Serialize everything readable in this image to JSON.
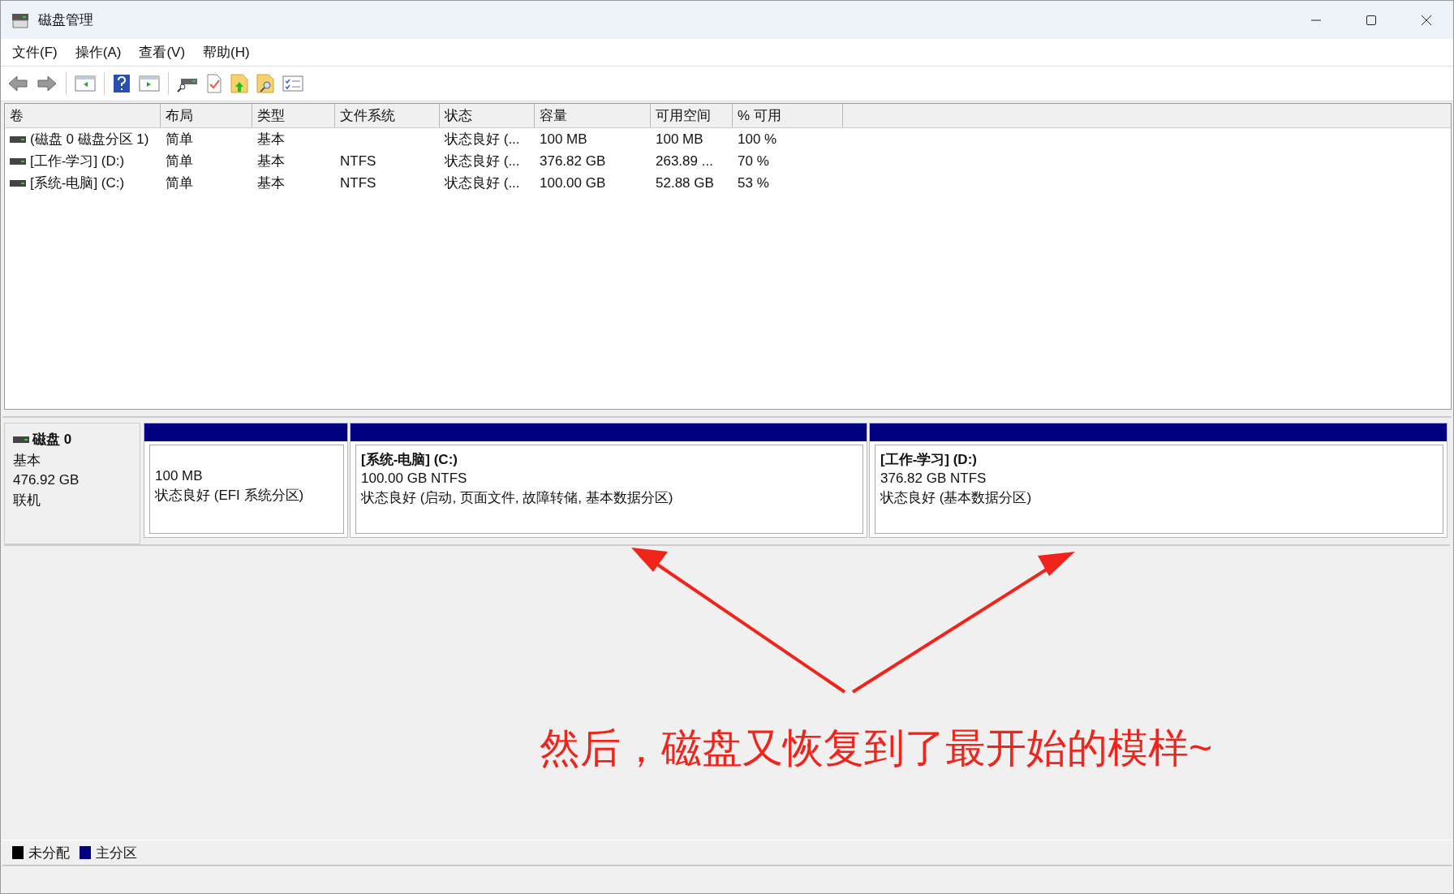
{
  "window": {
    "title": "磁盘管理"
  },
  "menu": [
    "文件(F)",
    "操作(A)",
    "查看(V)",
    "帮助(H)"
  ],
  "table": {
    "columns": [
      "卷",
      "布局",
      "类型",
      "文件系统",
      "状态",
      "容量",
      "可用空间",
      "% 可用"
    ],
    "rows": [
      {
        "cells": [
          "(磁盘 0 磁盘分区 1)",
          "简单",
          "基本",
          "",
          "状态良好 (...",
          "100 MB",
          "100 MB",
          "100 %"
        ]
      },
      {
        "cells": [
          "[工作-学习] (D:)",
          "简单",
          "基本",
          "NTFS",
          "状态良好 (...",
          "376.82 GB",
          "263.89 ...",
          "70 %"
        ]
      },
      {
        "cells": [
          "[系统-电脑] (C:)",
          "简单",
          "基本",
          "NTFS",
          "状态良好 (...",
          "100.00 GB",
          "52.88 GB",
          "53 %"
        ]
      }
    ]
  },
  "disk": {
    "name": "磁盘 0",
    "type": "基本",
    "size": "476.92 GB",
    "status": "联机",
    "partitions": [
      {
        "size": "100 MB",
        "status": "状态良好 (EFI 系统分区)",
        "color": "#000080"
      },
      {
        "title": "[系统-电脑]  (C:)",
        "size": "100.00 GB NTFS",
        "status": "状态良好 (启动, 页面文件, 故障转储, 基本数据分区)",
        "color": "#000080"
      },
      {
        "title": "[工作-学习]  (D:)",
        "size": "376.82 GB NTFS",
        "status": "状态良好 (基本数据分区)",
        "color": "#000080"
      }
    ]
  },
  "annotation": {
    "text": "然后，磁盘又恢复到了最开始的模样~"
  },
  "legend": [
    {
      "label": "未分配",
      "color": "#000000"
    },
    {
      "label": "主分区",
      "color": "#000080"
    }
  ]
}
